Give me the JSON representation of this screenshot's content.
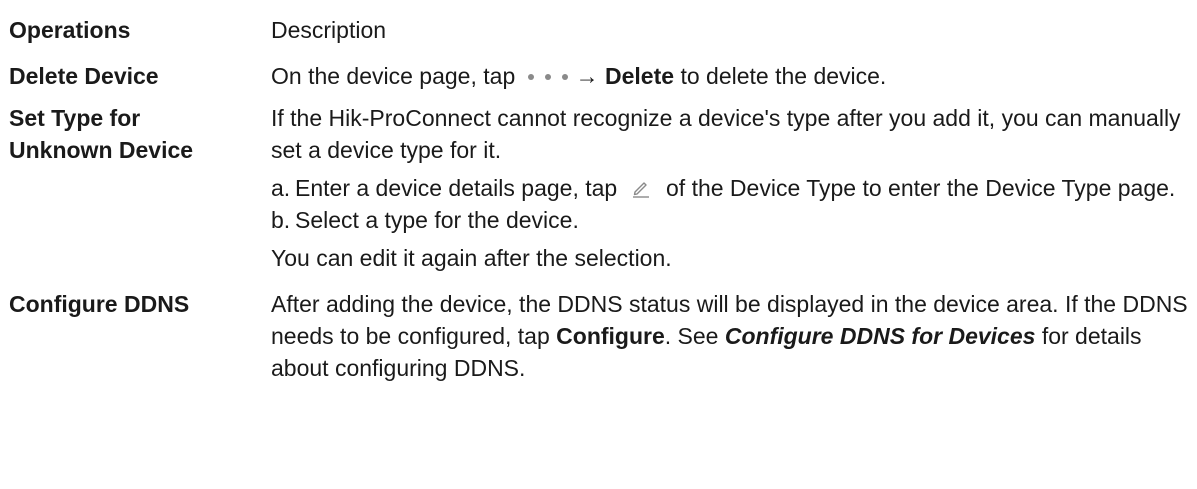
{
  "header": {
    "operations": "Operations",
    "description": "Description"
  },
  "rows": [
    {
      "operation": "Delete Device",
      "desc_before_icon": "On the device page, tap",
      "icon": "more-dots-icon",
      "arrow": "→",
      "desc_bold": "Delete",
      "desc_after": "to delete the device."
    },
    {
      "operation_line1": "Set Type for",
      "operation_line2": "Unknown Device",
      "intro": "If the Hik-ProConnect cannot recognize a device's type after you add it, you can manually set a device type for it.",
      "steps": [
        {
          "letter": "a.",
          "text_before_icon": "Enter a device details page, tap",
          "icon": "pencil-edit-icon",
          "text_after_icon": "of the Device Type to enter the Device Type page."
        },
        {
          "letter": "b.",
          "text": "Select a type for the device."
        }
      ],
      "note": "You can edit it again after the selection."
    },
    {
      "operation": "Configure DDNS",
      "desc_part1": "After adding the device, the DDNS status will be displayed in the device area. If the DDNS needs to be configured, tap",
      "desc_bold": "Configure",
      "desc_part2": ". See",
      "desc_link": "Configure DDNS for Devices",
      "desc_part3": "for details about configuring DDNS."
    }
  ],
  "colors": {
    "text": "#1a1a1a",
    "icon_gray": "#8a8a8a"
  }
}
